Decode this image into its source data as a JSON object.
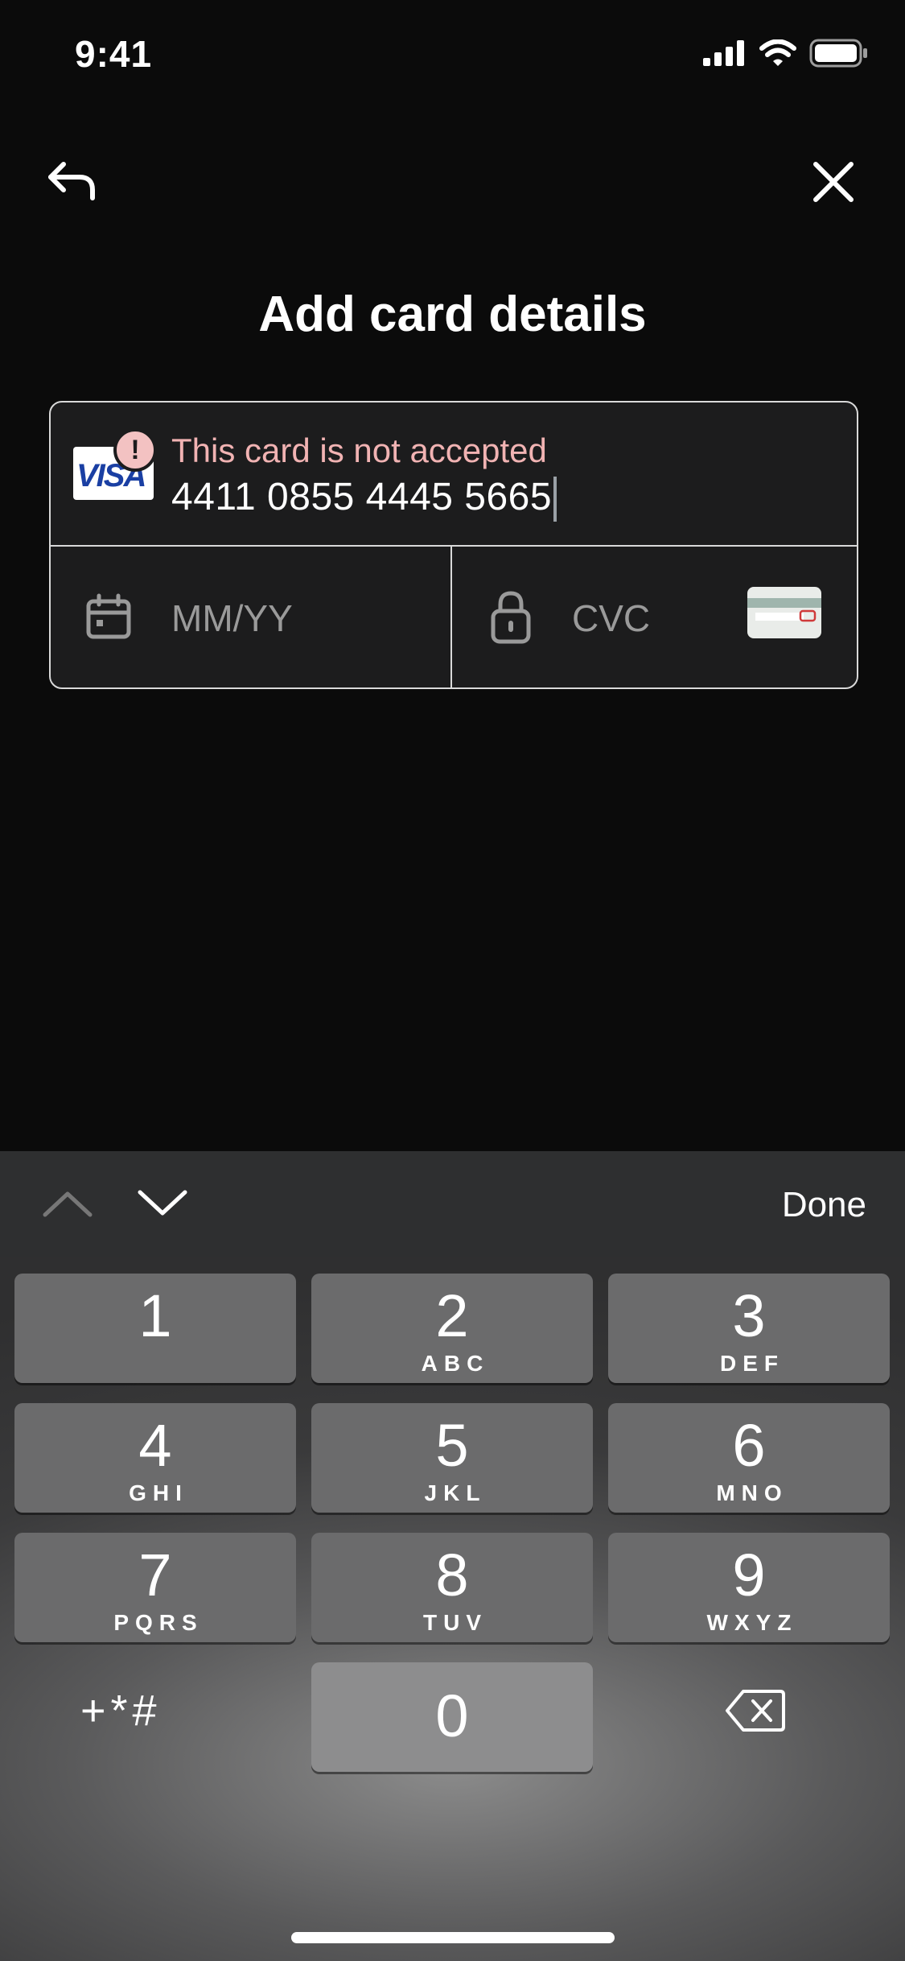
{
  "status_bar": {
    "time": "9:41"
  },
  "header": {
    "title": "Add card details"
  },
  "card_form": {
    "card_brand": "VISA",
    "error_message": "This card is not accepted",
    "card_number": "4411 0855 4445 5665",
    "expiry_placeholder": "MM/YY",
    "cvc_placeholder": "CVC"
  },
  "keyboard": {
    "done_label": "Done",
    "keys": [
      {
        "digit": "1",
        "letters": ""
      },
      {
        "digit": "2",
        "letters": "ABC"
      },
      {
        "digit": "3",
        "letters": "DEF"
      },
      {
        "digit": "4",
        "letters": "GHI"
      },
      {
        "digit": "5",
        "letters": "JKL"
      },
      {
        "digit": "6",
        "letters": "MNO"
      },
      {
        "digit": "7",
        "letters": "PQRS"
      },
      {
        "digit": "8",
        "letters": "TUV"
      },
      {
        "digit": "9",
        "letters": "WXYZ"
      },
      {
        "digit": "0",
        "letters": ""
      }
    ],
    "symbols_label": "+*#"
  },
  "colors": {
    "background": "#0b0b0b",
    "error_text": "#f1b3b3",
    "visa_blue": "#1a3fa3"
  }
}
